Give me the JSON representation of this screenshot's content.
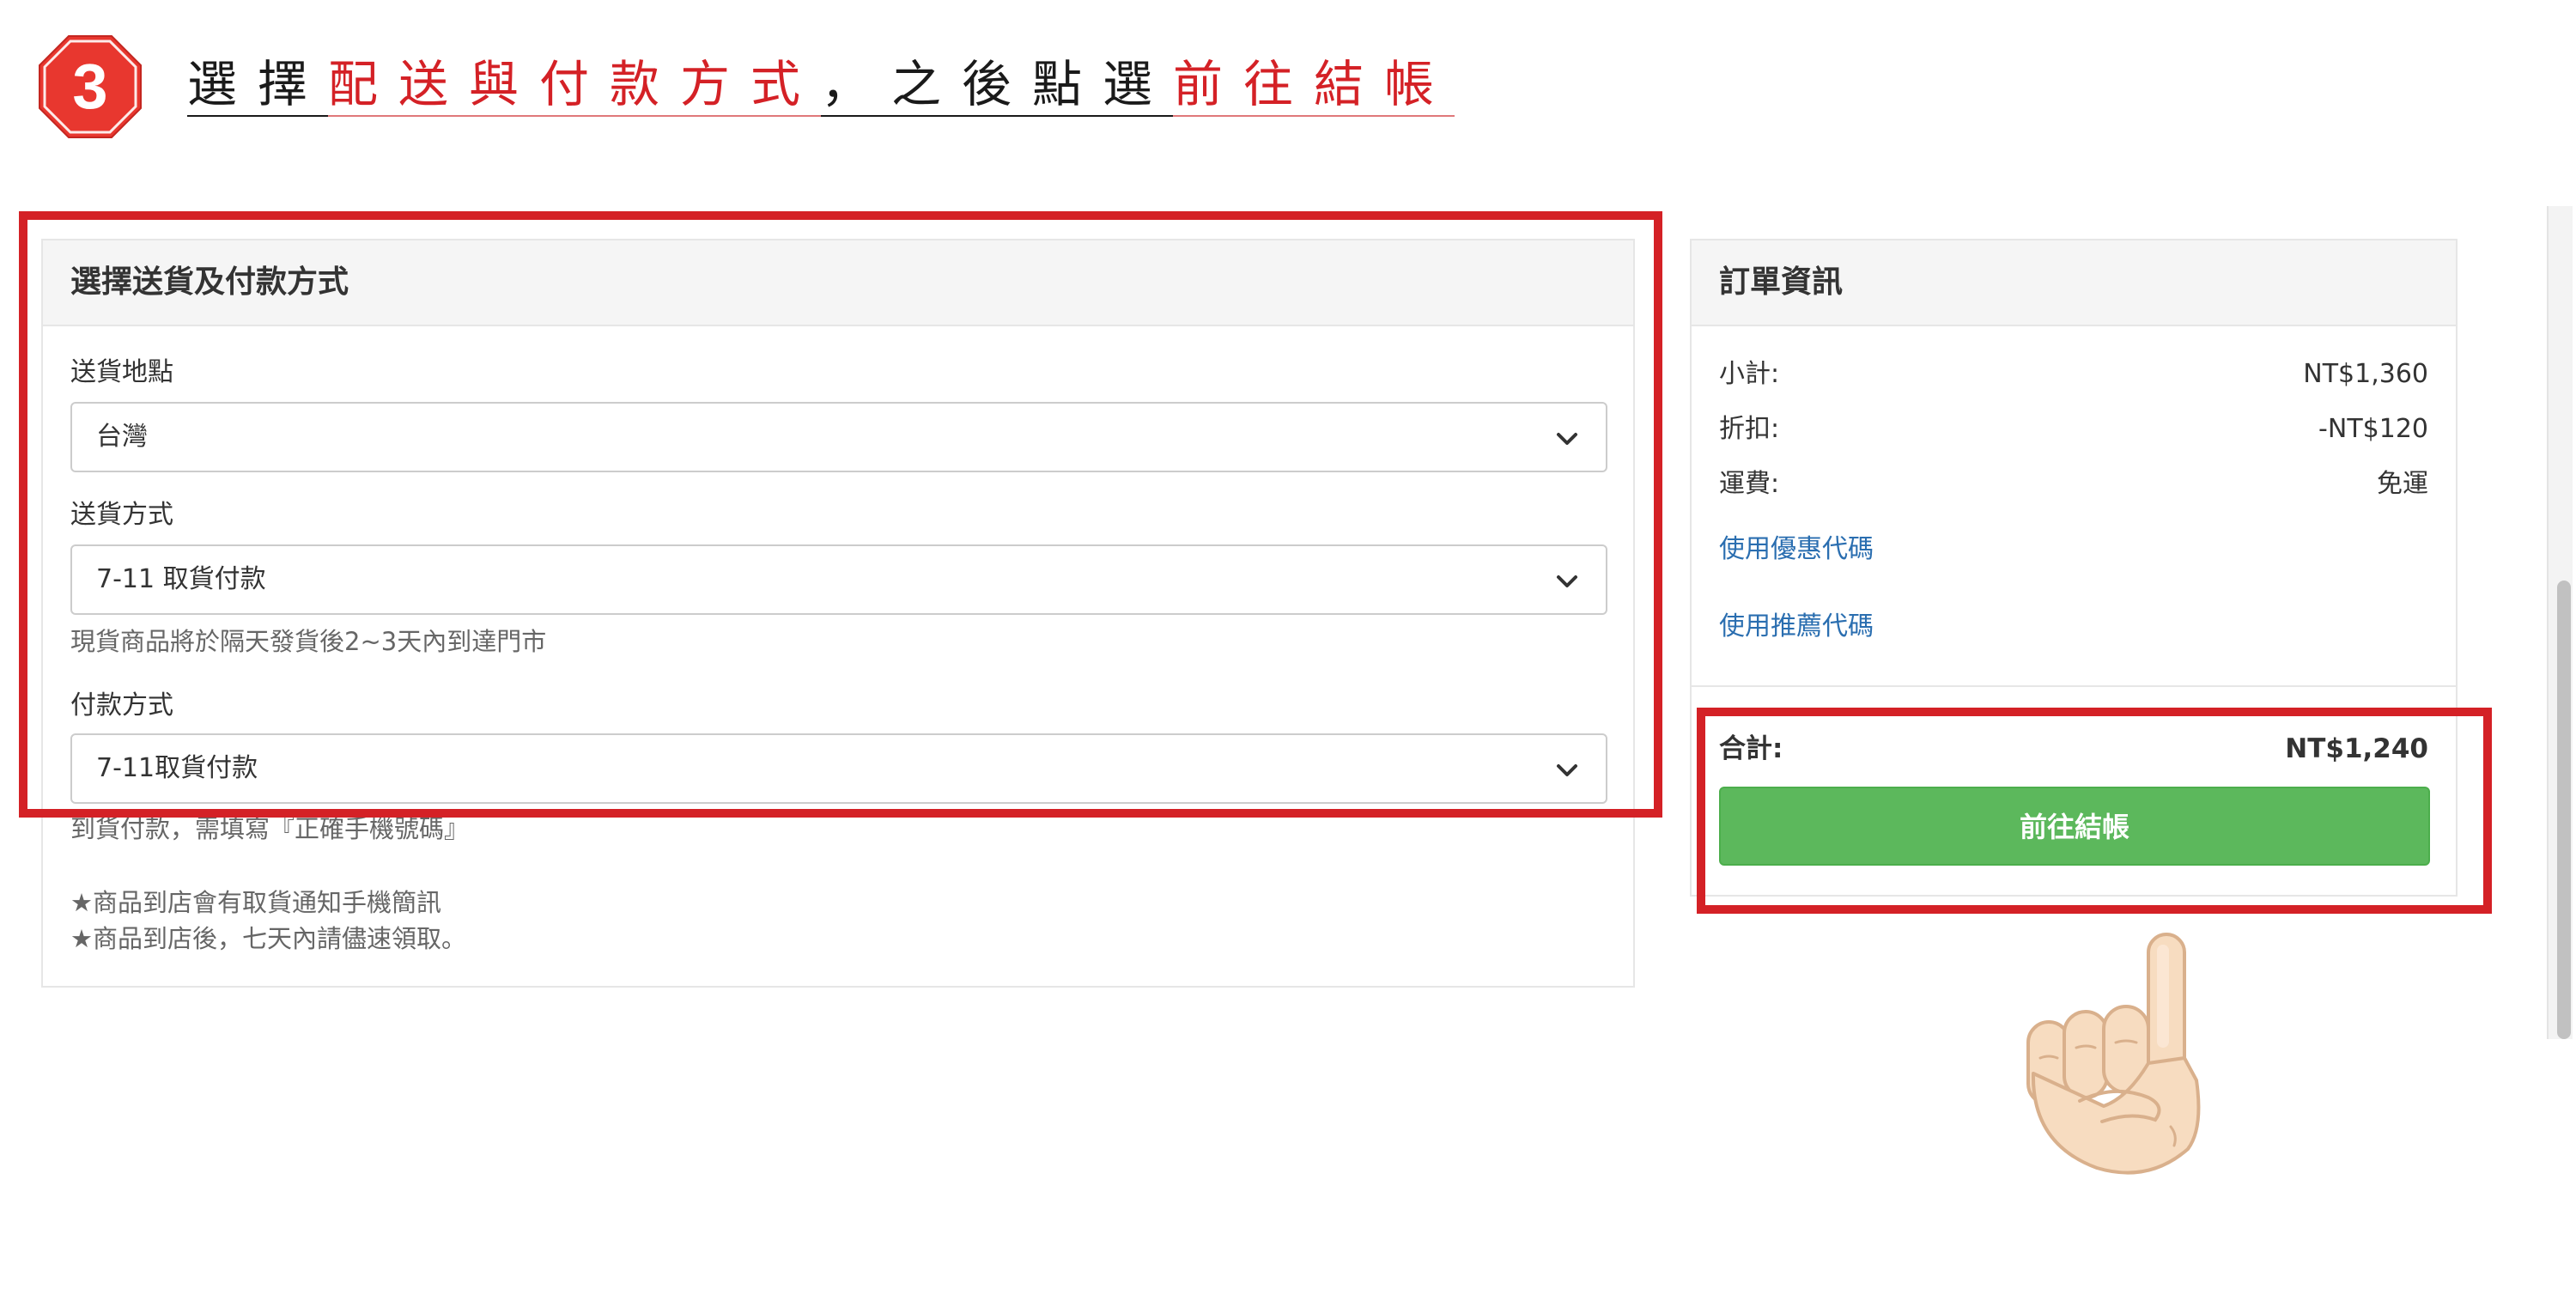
{
  "step": {
    "number": "3",
    "segments": [
      {
        "text": "選擇",
        "style": "black"
      },
      {
        "text": "配送與付款方式",
        "style": "red"
      },
      {
        "text": "，之後點選",
        "style": "black"
      },
      {
        "text": "前往結帳",
        "style": "red"
      }
    ]
  },
  "shipping_panel": {
    "title": "選擇送貨及付款方式",
    "location_label": "送貨地點",
    "location_value": "台灣",
    "method_label": "送貨方式",
    "method_value": "7-11 取貨付款",
    "method_hint": "現貨商品將於隔天發貨後2~3天內到達門市",
    "payment_label": "付款方式",
    "payment_value": "7-11取貨付款",
    "payment_hint": "到貨付款，需填寫『正確手機號碼』",
    "notes": [
      "★商品到店會有取貨通知手機簡訊",
      "★商品到店後，七天內請儘速領取。"
    ]
  },
  "order_panel": {
    "title": "訂單資訊",
    "subtotal_label": "小計:",
    "subtotal_value": "NT$1,360",
    "discount_label": "折扣:",
    "discount_value": "-NT$120",
    "shipping_label": "運費:",
    "shipping_value": "免運",
    "coupon_link": "使用優惠代碼",
    "referral_link": "使用推薦代碼",
    "total_label": "合計:",
    "total_value": "NT$1,240",
    "checkout_label": "前往結帳"
  },
  "colors": {
    "accent_red": "#d42126",
    "checkout_green": "#5cb85c",
    "link_blue": "#2a6eb0"
  },
  "icons": {
    "badge": "step-number-octagon-icon",
    "select_arrow": "chevron-down-icon",
    "pointer": "pointing-up-hand-icon"
  }
}
